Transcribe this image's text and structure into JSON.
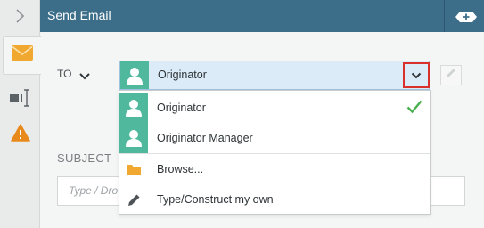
{
  "header": {
    "title": "Send Email"
  },
  "to": {
    "label": "TO",
    "selected": "Originator"
  },
  "dropdown": {
    "options": [
      {
        "label": "Originator",
        "selected": true
      },
      {
        "label": "Originator Manager",
        "selected": false
      }
    ],
    "actions": [
      {
        "label": "Browse...",
        "icon": "folder-icon"
      },
      {
        "label": "Type/Construct my own",
        "icon": "pencil-icon"
      }
    ]
  },
  "subject": {
    "label": "SUBJECT",
    "placeholder": "Type / Dro"
  },
  "colors": {
    "header": "#3c6e8a",
    "avatar": "#4fb89d",
    "combo_bg": "#dcebf8",
    "highlight_border": "#d9302c",
    "check": "#4caf50",
    "email_icon": "#f0a830",
    "warning_icon": "#e8891c"
  }
}
